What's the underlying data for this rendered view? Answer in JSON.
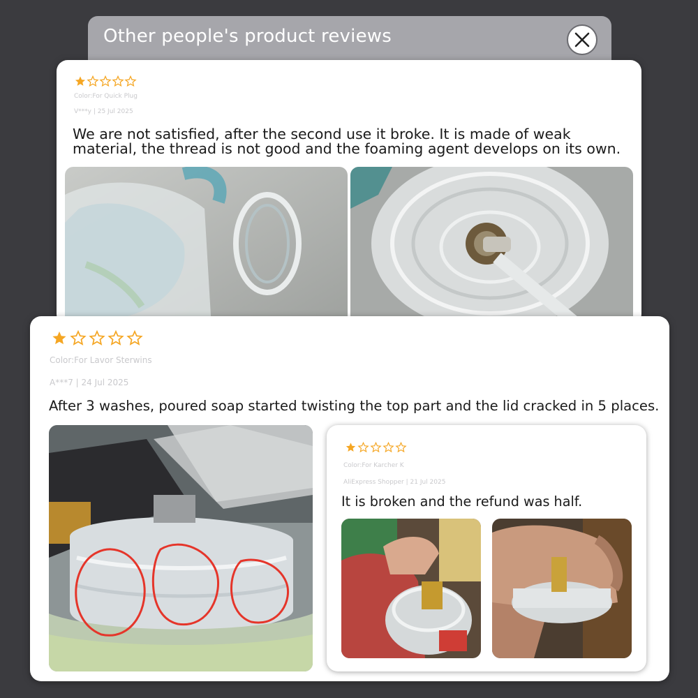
{
  "modal": {
    "title": "Other people's product reviews",
    "close_label": "close"
  },
  "reviews": [
    {
      "rating": 1,
      "max_rating": 5,
      "variant": "Color:For Quick Plug",
      "author_date": "V***y | 25 Jul 2025",
      "text": "We are not satisfied, after the second use it broke. It is made of weak material, the thread is not good and the foaming agent develops on its own.",
      "photos": [
        "photo-broken-bottle-neck",
        "photo-cracked-lid-closeup"
      ]
    },
    {
      "rating": 1,
      "max_rating": 5,
      "variant": "Color:For Lavor Sterwins",
      "author_date": "A***7 | 24 Jul 2025",
      "text": "After 3 washes, poured soap started twisting the top part and the lid cracked in 5 places.",
      "photos": [
        "photo-lid-cracks-circled"
      ]
    },
    {
      "rating": 1,
      "max_rating": 5,
      "variant": "Color:For Karcher K",
      "author_date": "AliExpress Shopper | 21 Jul 2025",
      "text": "It is broken and the refund was half.",
      "photos": [
        "photo-hand-holding-lid",
        "photo-hand-holding-lid-side"
      ]
    }
  ],
  "colors": {
    "star": "#f5a623",
    "header_bg": "#a6a6ab",
    "page_bg": "#3b3b3f"
  }
}
